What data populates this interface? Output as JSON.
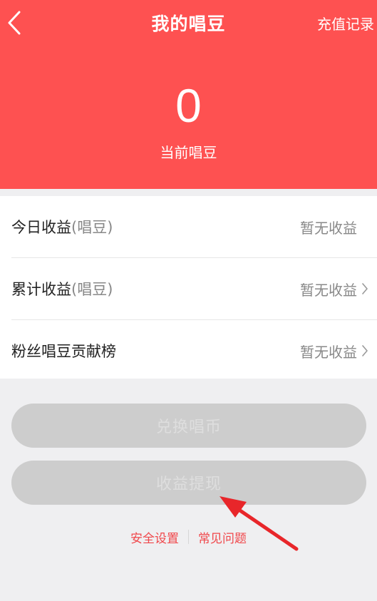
{
  "header": {
    "title": "我的唱豆",
    "recharge_label": "充值记录",
    "balance": "0",
    "balance_label": "当前唱豆",
    "accent_color": "#fe5151"
  },
  "list": {
    "rows": [
      {
        "label": "今日收益",
        "unit": "(唱豆)",
        "value": "暂无收益",
        "has_arrow": false
      },
      {
        "label": "累计收益",
        "unit": "(唱豆)",
        "value": "暂无收益",
        "has_arrow": true
      },
      {
        "label": "粉丝唱豆贡献榜",
        "unit": "",
        "value": "暂无收益",
        "has_arrow": true
      }
    ]
  },
  "actions": {
    "exchange_label": "兑换唱币",
    "withdraw_label": "收益提现"
  },
  "footer": {
    "security_label": "安全设置",
    "faq_label": "常见问题",
    "link_color": "#f0474b"
  },
  "icons": {
    "back": "chevron-left-icon",
    "row_arrow": "chevron-right-icon",
    "annotation": "red-arrow-annotation"
  }
}
